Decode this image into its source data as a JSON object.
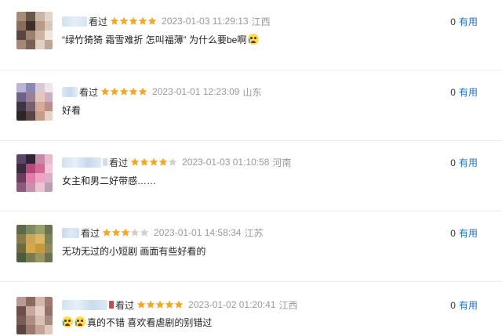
{
  "comments": [
    {
      "watched_label": "看过",
      "rating": 5,
      "time": "2023-01-03 11:29:13",
      "location": "江西",
      "content": "“绿竹猗猗 霜雪难折 怎叫福薄” 为什么要be啊",
      "content_emoji_prefix": 0,
      "content_emoji_suffix": 1,
      "useful_count": "0",
      "useful_label": "有用",
      "avatar_colors": [
        "#a98c78",
        "#6e5548",
        "#c9b6a8",
        "#e2d5cb",
        "#8c6d5c",
        "#3e2e2a",
        "#b89a86",
        "#d8c7b9",
        "#5b463e",
        "#9d7f6d",
        "#cbb5a2",
        "#f0e6de",
        "#a7877a",
        "#7a5f52",
        "#e0cfc2",
        "#bfa593"
      ]
    },
    {
      "watched_label": "看过",
      "rating": 5,
      "time": "2023-01-01 12:23:09",
      "location": "山东",
      "content": "好看",
      "content_emoji_prefix": 0,
      "content_emoji_suffix": 0,
      "useful_count": "0",
      "useful_label": "有用",
      "avatar_colors": [
        "#b9b4d8",
        "#8d87b8",
        "#d6c9d9",
        "#f1e4e6",
        "#6c6188",
        "#9b7f92",
        "#e4c7b8",
        "#c9b0c0",
        "#3f3445",
        "#7a5f70",
        "#d8a898",
        "#b98f86",
        "#2c2428",
        "#5b4446",
        "#c69c8a",
        "#e8d2c6"
      ]
    },
    {
      "watched_label": "看过",
      "rating": 4,
      "time": "2023-01-03 01:10:58",
      "location": "河南",
      "content": "女主和男二好带感……",
      "content_emoji_prefix": 0,
      "content_emoji_suffix": 0,
      "useful_count": "0",
      "useful_label": "有用",
      "avatar_colors": [
        "#5a4468",
        "#2e2438",
        "#c58aa8",
        "#e9b8cc",
        "#3c2a3e",
        "#b4487a",
        "#d46a98",
        "#f2c6d6",
        "#6c3b5e",
        "#e07aa6",
        "#f0a2c2",
        "#d9b0c4",
        "#8e5a7c",
        "#c890ac",
        "#eac4d4",
        "#b8a0b4"
      ]
    },
    {
      "watched_label": "看过",
      "rating": 3,
      "time": "2023-01-01 14:58:34",
      "location": "江苏",
      "content": "无功无过的小短剧 画面有些好看的",
      "content_emoji_prefix": 0,
      "content_emoji_suffix": 0,
      "useful_count": "0",
      "useful_label": "有用",
      "avatar_colors": [
        "#5c6a4a",
        "#7e8a5c",
        "#9aa06a",
        "#6a7452",
        "#8a7a4a",
        "#c8a858",
        "#d8b868",
        "#7c8456",
        "#6e6a40",
        "#d4a848",
        "#c89840",
        "#8a8a5c",
        "#4e5a3c",
        "#7a7c50",
        "#9a9460",
        "#6c7250"
      ]
    },
    {
      "watched_label": "看过",
      "rating": 5,
      "time": "2023-01-02 01:20:41",
      "location": "江西",
      "content": "真的不错 喜欢看虐剧的别错过",
      "content_emoji_prefix": 2,
      "content_emoji_suffix": 0,
      "useful_count": "0",
      "useful_label": "有用",
      "avatar_colors": [
        "#b89a92",
        "#8a6a64",
        "#d4b8ae",
        "#a07a70",
        "#6e4e48",
        "#c8a89c",
        "#e6d0c6",
        "#947068",
        "#7a5a52",
        "#b08c80",
        "#d8c0b4",
        "#a48a80",
        "#5c4440",
        "#9c7a70",
        "#c4a496",
        "#e0c8bc"
      ]
    }
  ],
  "colors": {
    "star_on": "#f5a623",
    "star_off": "#cfcfcf",
    "link": "#1a73c8",
    "muted": "#999999"
  }
}
